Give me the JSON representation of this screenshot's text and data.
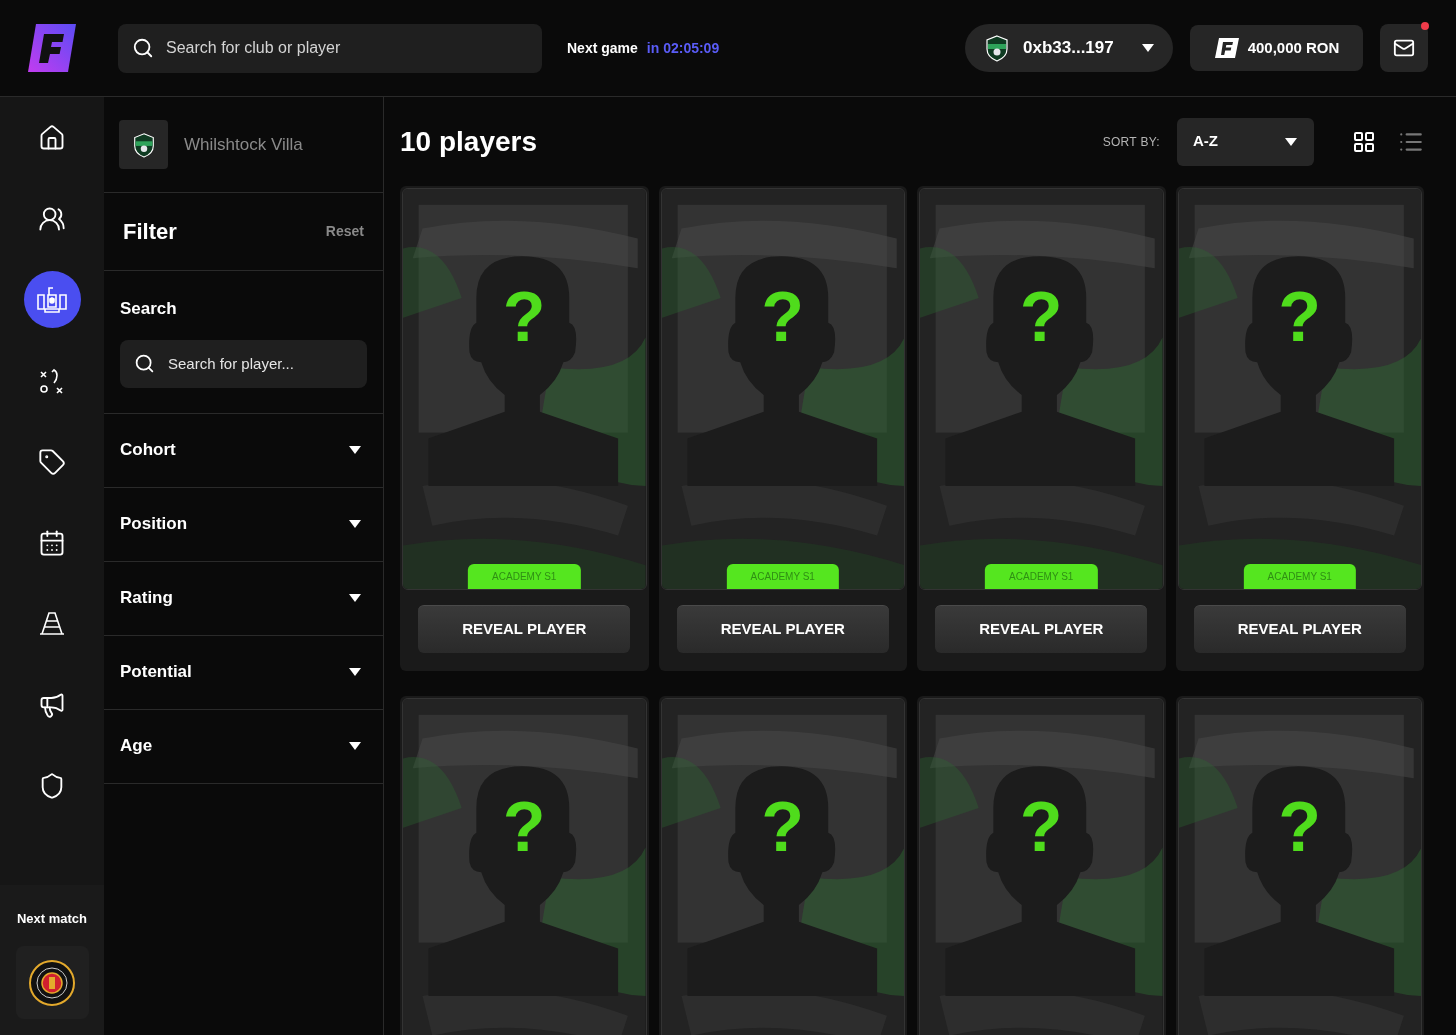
{
  "header": {
    "search": {
      "placeholder": "Search for club or player"
    },
    "next_game": {
      "label": "Next game",
      "countdown": "in 02:05:09"
    },
    "wallet": {
      "address": "0xb33...197"
    },
    "balance": "400,000 RON",
    "mail": {
      "unread": true
    }
  },
  "nav_items": [
    {
      "kind": "home",
      "selected": false
    },
    {
      "kind": "squad",
      "selected": false
    },
    {
      "kind": "club",
      "selected": true
    },
    {
      "kind": "tactics",
      "selected": false
    },
    {
      "kind": "market",
      "selected": false
    },
    {
      "kind": "calendar",
      "selected": false
    },
    {
      "kind": "training",
      "selected": false
    },
    {
      "kind": "news",
      "selected": false
    },
    {
      "kind": "league",
      "selected": false
    }
  ],
  "next_match": {
    "label": "Next match"
  },
  "filter": {
    "club": "Whilshtock Villa",
    "title": "Filter",
    "reset": "Reset",
    "search_label": "Search",
    "search_placeholder": "Search for player...",
    "sections": [
      {
        "label": "Cohort",
        "expanded": false
      },
      {
        "label": "Position",
        "expanded": false
      },
      {
        "label": "Rating",
        "expanded": false
      },
      {
        "label": "Potential",
        "expanded": false
      },
      {
        "label": "Age",
        "expanded": false
      }
    ]
  },
  "main": {
    "title": "10 players",
    "sort_label": "SORT BY:",
    "sort_value": "A-Z",
    "views": [
      {
        "kind": "grid",
        "selected": true
      },
      {
        "kind": "list",
        "selected": false
      }
    ],
    "cards": [
      {
        "mark": "?",
        "tag": "ACADEMY S1",
        "button": "REVEAL PLAYER"
      },
      {
        "mark": "?",
        "tag": "ACADEMY S1",
        "button": "REVEAL PLAYER"
      },
      {
        "mark": "?",
        "tag": "ACADEMY S1",
        "button": "REVEAL PLAYER"
      },
      {
        "mark": "?",
        "tag": "ACADEMY S1",
        "button": "REVEAL PLAYER"
      },
      {
        "mark": "?"
      },
      {
        "mark": "?"
      },
      {
        "mark": "?"
      },
      {
        "mark": "?"
      }
    ]
  }
}
